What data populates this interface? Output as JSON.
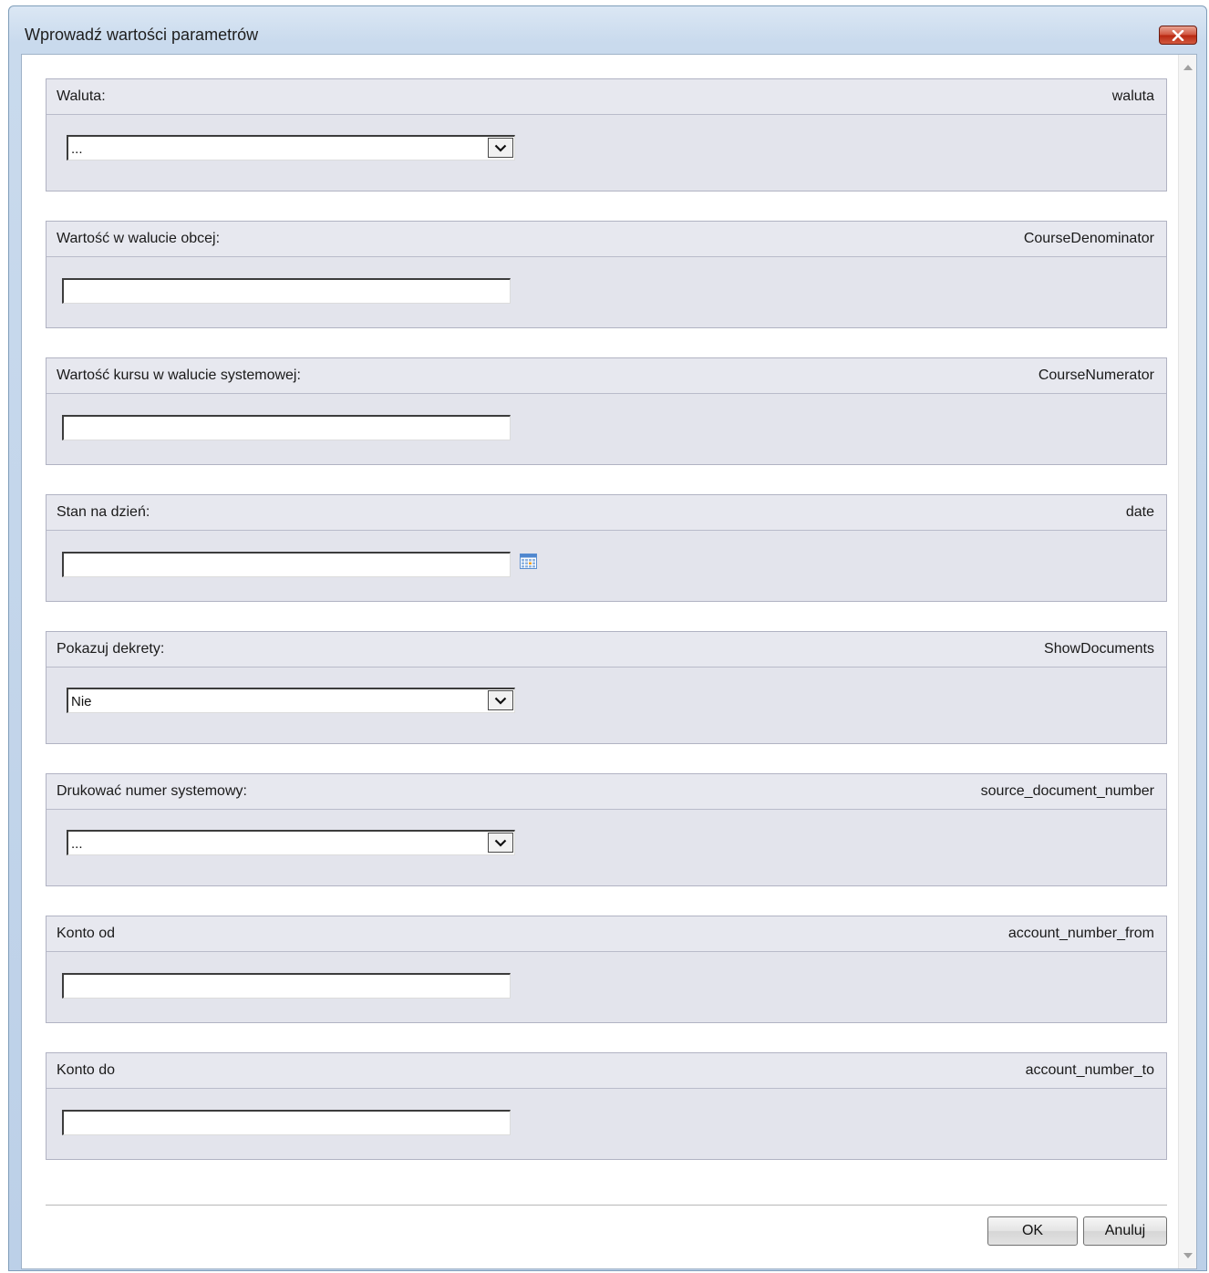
{
  "dialog": {
    "title": "Wprowadź wartości parametrów"
  },
  "params": {
    "waluta": {
      "label": "Waluta:",
      "name": "waluta",
      "value": "..."
    },
    "course_denominator": {
      "label": "Wartość w walucie obcej:",
      "name": "CourseDenominator",
      "value": ""
    },
    "course_numerator": {
      "label": "Wartość kursu w walucie systemowej:",
      "name": "CourseNumerator",
      "value": ""
    },
    "date": {
      "label": "Stan na dzień:",
      "name": "date",
      "value": ""
    },
    "show_documents": {
      "label": "Pokazuj dekrety:",
      "name": "ShowDocuments",
      "value": "Nie"
    },
    "source_document_number": {
      "label": "Drukować numer systemowy:",
      "name": "source_document_number",
      "value": "..."
    },
    "account_number_from": {
      "label": "Konto od",
      "name": "account_number_from",
      "value": ""
    },
    "account_number_to": {
      "label": "Konto do",
      "name": "account_number_to",
      "value": ""
    }
  },
  "buttons": {
    "ok": "OK",
    "cancel": "Anuluj"
  },
  "icons": {
    "close": "close-icon",
    "dropdown": "chevron-down-icon",
    "calendar": "calendar-icon",
    "scroll_up": "scroll-up-icon",
    "scroll_down": "scroll-down-icon"
  },
  "colors": {
    "panel_bg": "#e3e4ec",
    "close_button": "#c9432e",
    "window_frame": "#c9daed"
  }
}
